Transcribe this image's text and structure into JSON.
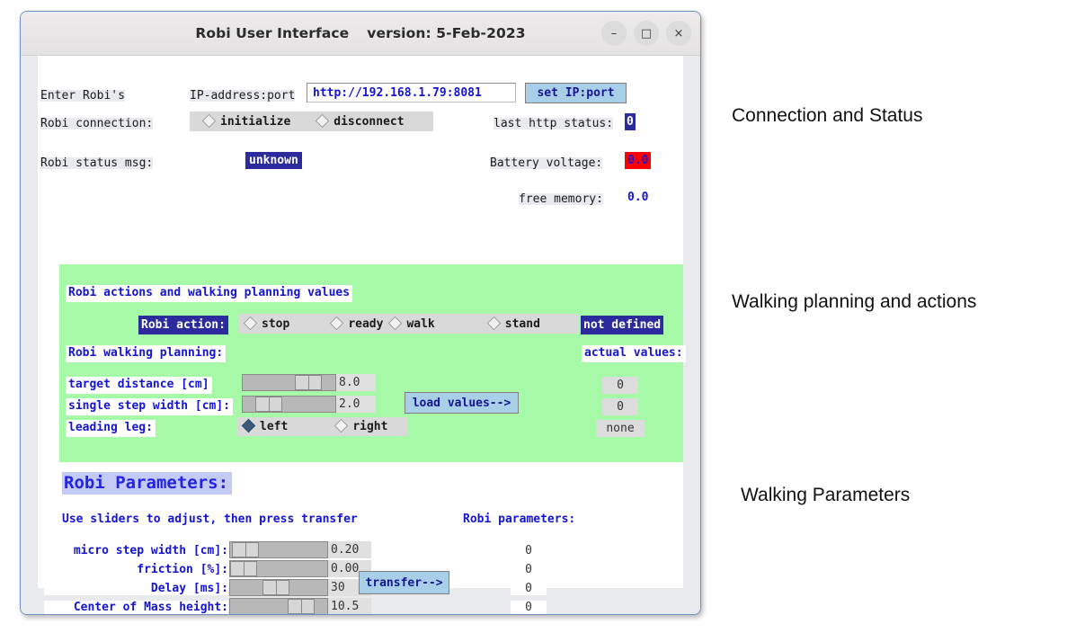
{
  "window": {
    "title": "Robi User Interface",
    "version": "version: 5-Feb-2023",
    "buttons": {
      "minimize": "–",
      "maximize": "□",
      "close": "×"
    }
  },
  "connection": {
    "enter_label": "Enter Robi's",
    "ip_label": "IP-address:port",
    "ip_value": "http://192.168.1.79:8081",
    "set_ip_button": "set IP:port",
    "connection_label": "Robi connection:",
    "options": [
      {
        "label": "initialize",
        "selected": false
      },
      {
        "label": "disconnect",
        "selected": false
      }
    ],
    "status_msg_label": "Robi status msg:",
    "status_msg_value": "unknown",
    "http_status_label": "last http status:",
    "http_status_value": "0",
    "battery_label": "Battery voltage:",
    "battery_value": "0.0",
    "memory_label": "free memory:",
    "memory_value": "0.0"
  },
  "walking": {
    "panel_title": "Robi actions and walking planning values",
    "action_label": "Robi action:",
    "action_options": [
      {
        "label": "stop",
        "selected": false
      },
      {
        "label": "ready",
        "selected": false
      },
      {
        "label": "walk",
        "selected": false
      },
      {
        "label": "stand",
        "selected": false
      }
    ],
    "action_state": "not defined",
    "planning_label": "Robi walking planning:",
    "actual_values_label": "actual values:",
    "rows": [
      {
        "label": "target distance [cm]",
        "value": "8.0",
        "knob": 0.62,
        "actual": "0"
      },
      {
        "label": "single step width [cm]:",
        "value": "2.0",
        "knob": 0.18,
        "actual": "0"
      }
    ],
    "leading_leg_label": "leading leg:",
    "leading_leg_options": [
      {
        "label": "left",
        "selected": true
      },
      {
        "label": "right",
        "selected": false
      }
    ],
    "leading_leg_actual": "none",
    "load_button": "load values-->"
  },
  "parameters": {
    "heading": "Robi Parameters:",
    "hint": "Use sliders to adjust, then press transfer",
    "actual_header": "Robi parameters:",
    "transfer_button": "transfer-->",
    "rows": [
      {
        "label": "micro step width [cm]:",
        "value": "0.20",
        "knob": 0.03,
        "actual": "0"
      },
      {
        "label": "friction [%]:",
        "value": "0.00",
        "knob": 0.0,
        "actual": "0"
      },
      {
        "label": "Delay [ms]:",
        "value": "30",
        "knob": 0.33,
        "actual": "0"
      },
      {
        "label": "Center of Mass height:",
        "value": "10.5",
        "knob": 0.58,
        "actual": "0"
      }
    ]
  },
  "annotations": [
    {
      "text": "Connection and Status"
    },
    {
      "text": "Walking planning and actions"
    },
    {
      "text": "Walking Parameters"
    }
  ],
  "colors": {
    "green_panel": "#a6f9a6",
    "accent_blue": "#1414d2",
    "dark_blue": "#2b2b9e",
    "alert_red": "#ff0000",
    "button_blue": "#a9cfe8"
  }
}
